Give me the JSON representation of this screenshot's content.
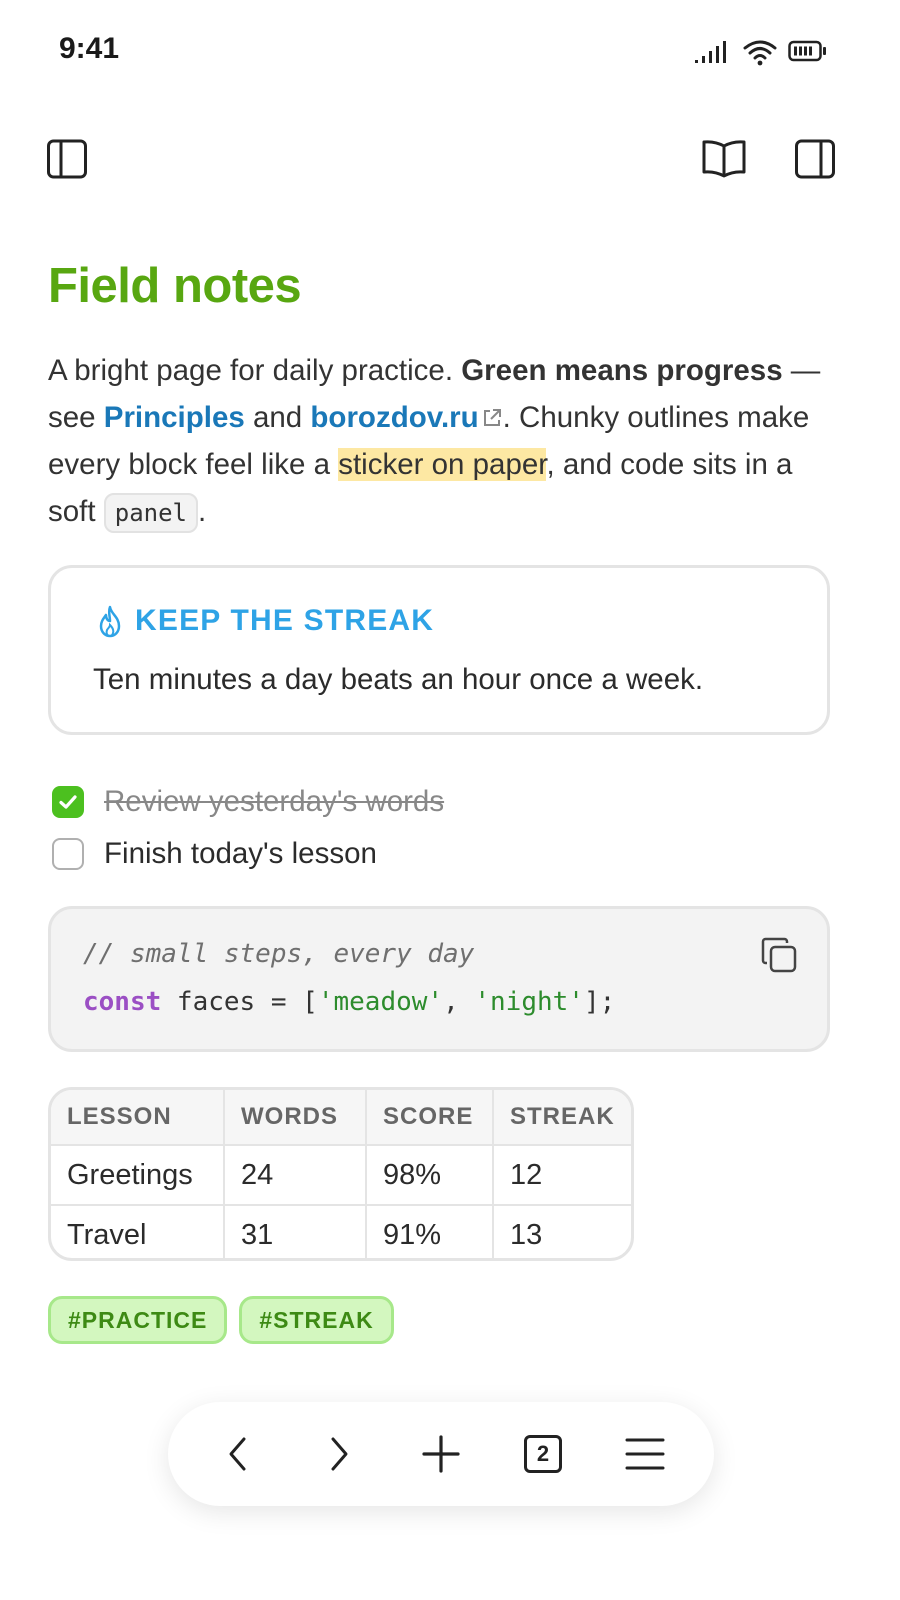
{
  "status_bar": {
    "time": "9:41",
    "icons": [
      "signal-icon",
      "wifi-icon",
      "battery-icon"
    ]
  },
  "toolbar": {
    "icons": [
      "sidebar-left-icon",
      "reader-book-icon",
      "sidebar-right-icon"
    ]
  },
  "page": {
    "title": "Field notes",
    "intro": {
      "p1": "A bright page for daily practice. ",
      "bold": "Green means progress",
      "p2": " — see ",
      "link1": "Principles",
      "p3": " and ",
      "link2": "borozdov.ru",
      "p4": ". Chunky outlines make every block feel like a ",
      "highlight": "sticker on paper",
      "p5": ", and code sits in a soft ",
      "code": "panel",
      "p6": "."
    }
  },
  "callout": {
    "icon": "flame-icon",
    "title": "KEEP THE STREAK",
    "body": "Ten minutes a day beats an hour once a week."
  },
  "tasks": [
    {
      "label": "Review yesterday's words",
      "checked": true
    },
    {
      "label": "Finish today's lesson",
      "checked": false
    }
  ],
  "code_block": {
    "comment": "// small steps, every day",
    "keyword": "const",
    "ident": " faces = [",
    "str1": "'meadow'",
    "sep": ", ",
    "str2": "'night'",
    "end": "];"
  },
  "table": {
    "headers": [
      "LESSON",
      "WORDS",
      "SCORE",
      "STREAK"
    ],
    "rows": [
      [
        "Greetings",
        "24",
        "98%",
        "12"
      ],
      [
        "Travel",
        "31",
        "91%",
        "13"
      ]
    ]
  },
  "tags": [
    "#PRACTICE",
    "#STREAK"
  ],
  "bottom_nav": {
    "tab_count": "2",
    "icons": [
      "back-icon",
      "forward-icon",
      "plus-icon",
      "tabs-icon",
      "menu-icon"
    ]
  },
  "colors": {
    "title_green": "#58a711",
    "link_blue": "#1a78b8",
    "callout_blue": "#2ea3e6",
    "check_green": "#4cc01f",
    "highlight": "#fde8a3"
  }
}
